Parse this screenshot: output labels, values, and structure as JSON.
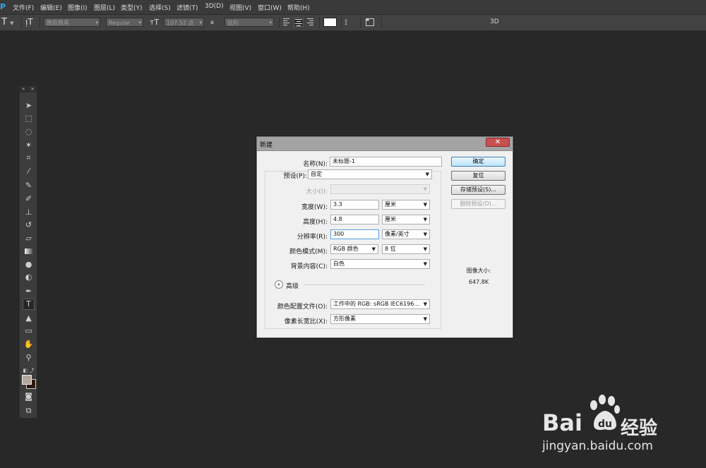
{
  "menubar": {
    "logo": "Ps",
    "items": [
      "文件(F)",
      "编辑(E)",
      "图像(I)",
      "图层(L)",
      "类型(Y)",
      "选择(S)",
      "滤镜(T)",
      "3D(D)",
      "视图(V)",
      "窗口(W)",
      "帮助(H)"
    ]
  },
  "options_bar": {
    "tool_glyph": "T",
    "font_family": "微软雅黑",
    "font_style": "Regular",
    "font_size": "107.52 点",
    "antialias_badge": "a",
    "antialias": "锐利",
    "mode_3d": "3D",
    "text_color": "#ffffff"
  },
  "dialog": {
    "title": "新建",
    "close_glyph": "✕",
    "name": {
      "label": "名称(N):",
      "value": "未标题-1"
    },
    "preset": {
      "label": "预设(P):",
      "value": "自定"
    },
    "size": {
      "label": "大小(I):",
      "value": ""
    },
    "width": {
      "label": "宽度(W):",
      "value": "3.3",
      "unit": "厘米"
    },
    "height": {
      "label": "高度(H):",
      "value": "4.8",
      "unit": "厘米"
    },
    "resolution": {
      "label": "分辨率(R):",
      "value": "300",
      "unit": "像素/英寸"
    },
    "color_mode": {
      "label": "颜色模式(M):",
      "value": "RGB 颜色",
      "depth": "8 位"
    },
    "background": {
      "label": "背景内容(C):",
      "value": "白色"
    },
    "advanced": {
      "label": "高级",
      "icon_glyph": "»"
    },
    "color_profile": {
      "label": "颜色配置文件(O):",
      "value": "工作中的 RGB: sRGB IEC6196..."
    },
    "pixel_aspect": {
      "label": "像素长宽比(X):",
      "value": "方形像素"
    },
    "buttons": {
      "ok": "确定",
      "reset": "复位",
      "save_preset": "存储预设(S)...",
      "delete_preset": "删除预设(D)..."
    },
    "image_size_label": "图像大小:",
    "image_size_value": "647.8K"
  },
  "watermark": {
    "brand_left": "Bai",
    "brand_right": "经验",
    "url": "jingyan.baidu.com"
  }
}
